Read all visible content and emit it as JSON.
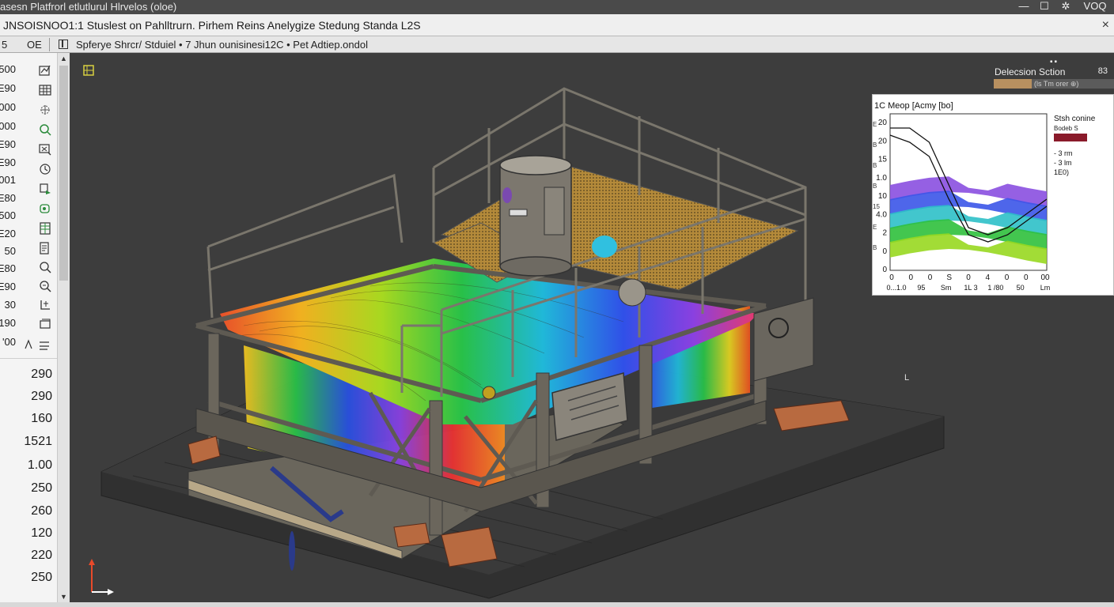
{
  "window": {
    "title": "asesn Platfrorl etlutlurul Hlrvelos (oloe)",
    "minimize_icon": "minimize-icon",
    "maximize_icon": "maximize-icon",
    "pin_icon": "pin-icon",
    "extra": "VOQ"
  },
  "document": {
    "title": "JNSOISNOO1:1 Stuslest on Pahlltrurn. Pirhem Reins Anelygize Stedung Standa L2S",
    "close_label": "×"
  },
  "subbar": {
    "col1_a": "5",
    "col1_b": "OE",
    "breadcrumb": "Spferye Shrcr/ Stduiel  •  7 Jhun ounisinesi12C  •  Pet Adtiep.ondol"
  },
  "row_numbers": [
    "500",
    "E90",
    "000",
    "000",
    "E90",
    "E90",
    "001",
    "E80",
    "500",
    "E20",
    "50",
    "E80",
    "E90",
    "30",
    "190",
    "'00"
  ],
  "lower_values": [
    "290",
    "290",
    "160",
    "1521",
    "1.00",
    "250",
    "260",
    "120",
    "220",
    "250"
  ],
  "tools": [
    "chart-edit-icon",
    "grid-icon",
    "mesh-icon",
    "circle-search-icon",
    "filter-icon",
    "clock-icon",
    "probe-icon",
    "node-icon",
    "table-icon",
    "list-icon",
    "zoom-icon",
    "zoom-fit-icon",
    "axis-icon",
    "layer-icon",
    "align-icon"
  ],
  "legend": {
    "title": "Delecsion Sction",
    "value": "83",
    "bar_label": "(ls Tm orer ⊕)"
  },
  "chart_data": {
    "type": "area",
    "title": "1C Meop [Acmy [bo]",
    "yticks": [
      "20",
      "20",
      "15",
      "1.0",
      "10",
      "4.0",
      "2",
      "0",
      "0"
    ],
    "y_side_labels": [
      "E",
      "B",
      "B",
      "B",
      "15",
      "E",
      "B"
    ],
    "xticks": [
      "0",
      "0",
      "0",
      "S",
      "0",
      "4",
      "0",
      "0",
      "00"
    ],
    "xlabels": [
      "0...1.0",
      "95",
      "Sm",
      "1L 3",
      "1 /80",
      "50",
      "Lm"
    ],
    "legend_title": "Stsh conine",
    "legend_sub": "Bodeb S",
    "legend_items": [
      "3 rm",
      "3 lm",
      "1E0)"
    ],
    "series": [
      {
        "name": "",
        "values": [
          20,
          20,
          18,
          12,
          6,
          5,
          6,
          8,
          10
        ]
      },
      {
        "name": "",
        "values": [
          19,
          18,
          16,
          10,
          5,
          4,
          5,
          7,
          9
        ]
      }
    ],
    "bands": [
      "#8a4fe0",
      "#3b55e8",
      "#2ec0c8",
      "#2fc03c",
      "#98d820"
    ],
    "xlim": [
      0,
      8
    ],
    "ylim": [
      0,
      22
    ]
  },
  "viewport": {
    "axis_marker": "L",
    "origin_icon": "origin-axes-icon"
  }
}
